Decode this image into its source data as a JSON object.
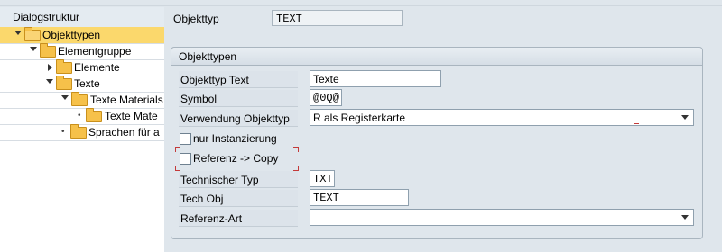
{
  "tree": {
    "header": "Dialogstruktur",
    "items": [
      {
        "label": "Objekttypen"
      },
      {
        "label": "Elementgruppe"
      },
      {
        "label": "Elemente"
      },
      {
        "label": "Texte"
      },
      {
        "label": "Texte Materials"
      },
      {
        "label": "Texte Mate"
      },
      {
        "label": "Sprachen für a"
      }
    ]
  },
  "header": {
    "objekttyp_label": "Objekttyp",
    "objekttyp_value": "TEXT"
  },
  "group": {
    "title": "Objekttypen",
    "fields": {
      "objekttyp_text_label": "Objekttyp Text",
      "objekttyp_text_value": "Texte",
      "symbol_label": "Symbol",
      "symbol_value": "@0Q@",
      "verwendung_label": "Verwendung Objekttyp",
      "verwendung_value": "R als Registerkarte",
      "nur_instanzierung_label": "nur Instanzierung",
      "nur_instanzierung_checked": false,
      "referenz_copy_label": "Referenz -> Copy",
      "referenz_copy_checked": false,
      "technischer_typ_label": "Technischer Typ",
      "technischer_typ_value": "TXT",
      "tech_obj_label": "Tech Obj",
      "tech_obj_value": "TEXT",
      "referenz_art_label": "Referenz-Art",
      "referenz_art_value": ""
    }
  }
}
